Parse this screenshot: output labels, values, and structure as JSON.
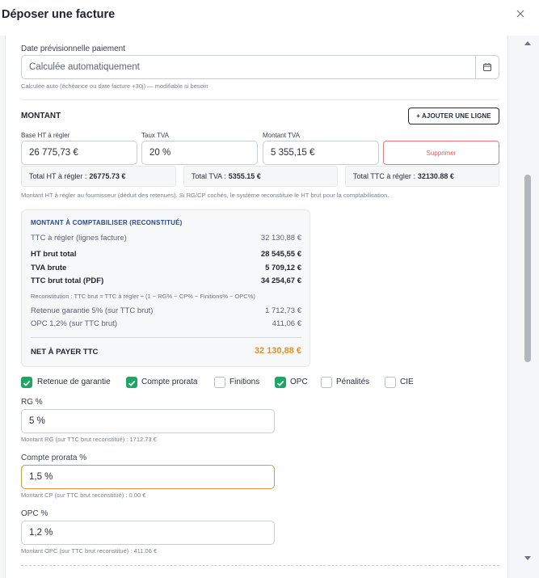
{
  "modal": {
    "title": "Déposer une facture"
  },
  "payment_date": {
    "label": "Date prévisionnelle paiement",
    "value": "Calculée automatiquement",
    "hint": "Calculée auto (échéance ou date facture +30j) — modifiable si besoin"
  },
  "montant": {
    "title": "MONTANT",
    "add_line_label": "+ AJOUTER UNE LIGNE",
    "base_label": "Base HT à régler",
    "base_value": "26 775,73 €",
    "taux_label": "Taux TVA",
    "taux_value": "20 %",
    "tva_label": "Montant TVA",
    "tva_value": "5 355,15 €",
    "delete_label": "Supprimer",
    "total_ht_label": "Total HT à régler :",
    "total_ht_value": "26775.73 €",
    "total_tva_label": "Total TVA :",
    "total_tva_value": "5355.15 €",
    "total_ttc_label": "Total TTC à régler :",
    "total_ttc_value": "32130.88 €",
    "hint": "Montant HT à régler au fournisseur (déduit des retenues). Si RG/CP cochés, le système reconstituie le HT brut pour la comptabilisation."
  },
  "card": {
    "title": "MONTANT À COMPTABILISER (RECONSTITUÉ)",
    "rows": [
      {
        "label": "TTC à régler (lignes facture)",
        "value": "32 130,88 €"
      },
      {
        "label": "HT brut total",
        "value": "28 545,55 €"
      },
      {
        "label": "TVA brute",
        "value": "5 709,12 €"
      },
      {
        "label": "TTC brut total (PDF)",
        "value": "34 254,67 €"
      }
    ],
    "formula": "Reconstitution : TTC brut = TTC à régler ÷ (1 − RG% − CP% − Finitions% − OPC%)",
    "rows2": [
      {
        "label": "Retenue garantie 5% (sur TTC brut)",
        "value": "1 712,73 €"
      },
      {
        "label": "OPC 1,2% (sur TTC brut)",
        "value": "411,06 €"
      }
    ],
    "net_label": "NET À PAYER TTC",
    "net_value": "32 130,88 €"
  },
  "options": [
    {
      "label": "Retenue de garantie",
      "checked": true
    },
    {
      "label": "Compte prorata",
      "checked": true
    },
    {
      "label": "Finitions",
      "checked": false
    },
    {
      "label": "OPC",
      "checked": true
    },
    {
      "label": "Pénalités",
      "checked": false
    },
    {
      "label": "CIE",
      "checked": false
    }
  ],
  "rg": {
    "label": "RG %",
    "value": "5 %",
    "hint": "Montant RG (sur TTC brut reconstitué) : 1712.73 €"
  },
  "cp": {
    "label": "Compte prorata %",
    "value": "1,5 %",
    "hint": "Montant CP (sur TTC brut reconstitué) : 0.00 €"
  },
  "opc": {
    "label": "OPC %",
    "value": "1,2 %",
    "hint": "Montant OPC (sur TTC brut reconstitué) : 411.06 €"
  },
  "colors": {
    "accent_green": "#1fa565",
    "net_orange": "#e08f2a",
    "focus_border": "#d39a45",
    "danger": "#e06060"
  }
}
